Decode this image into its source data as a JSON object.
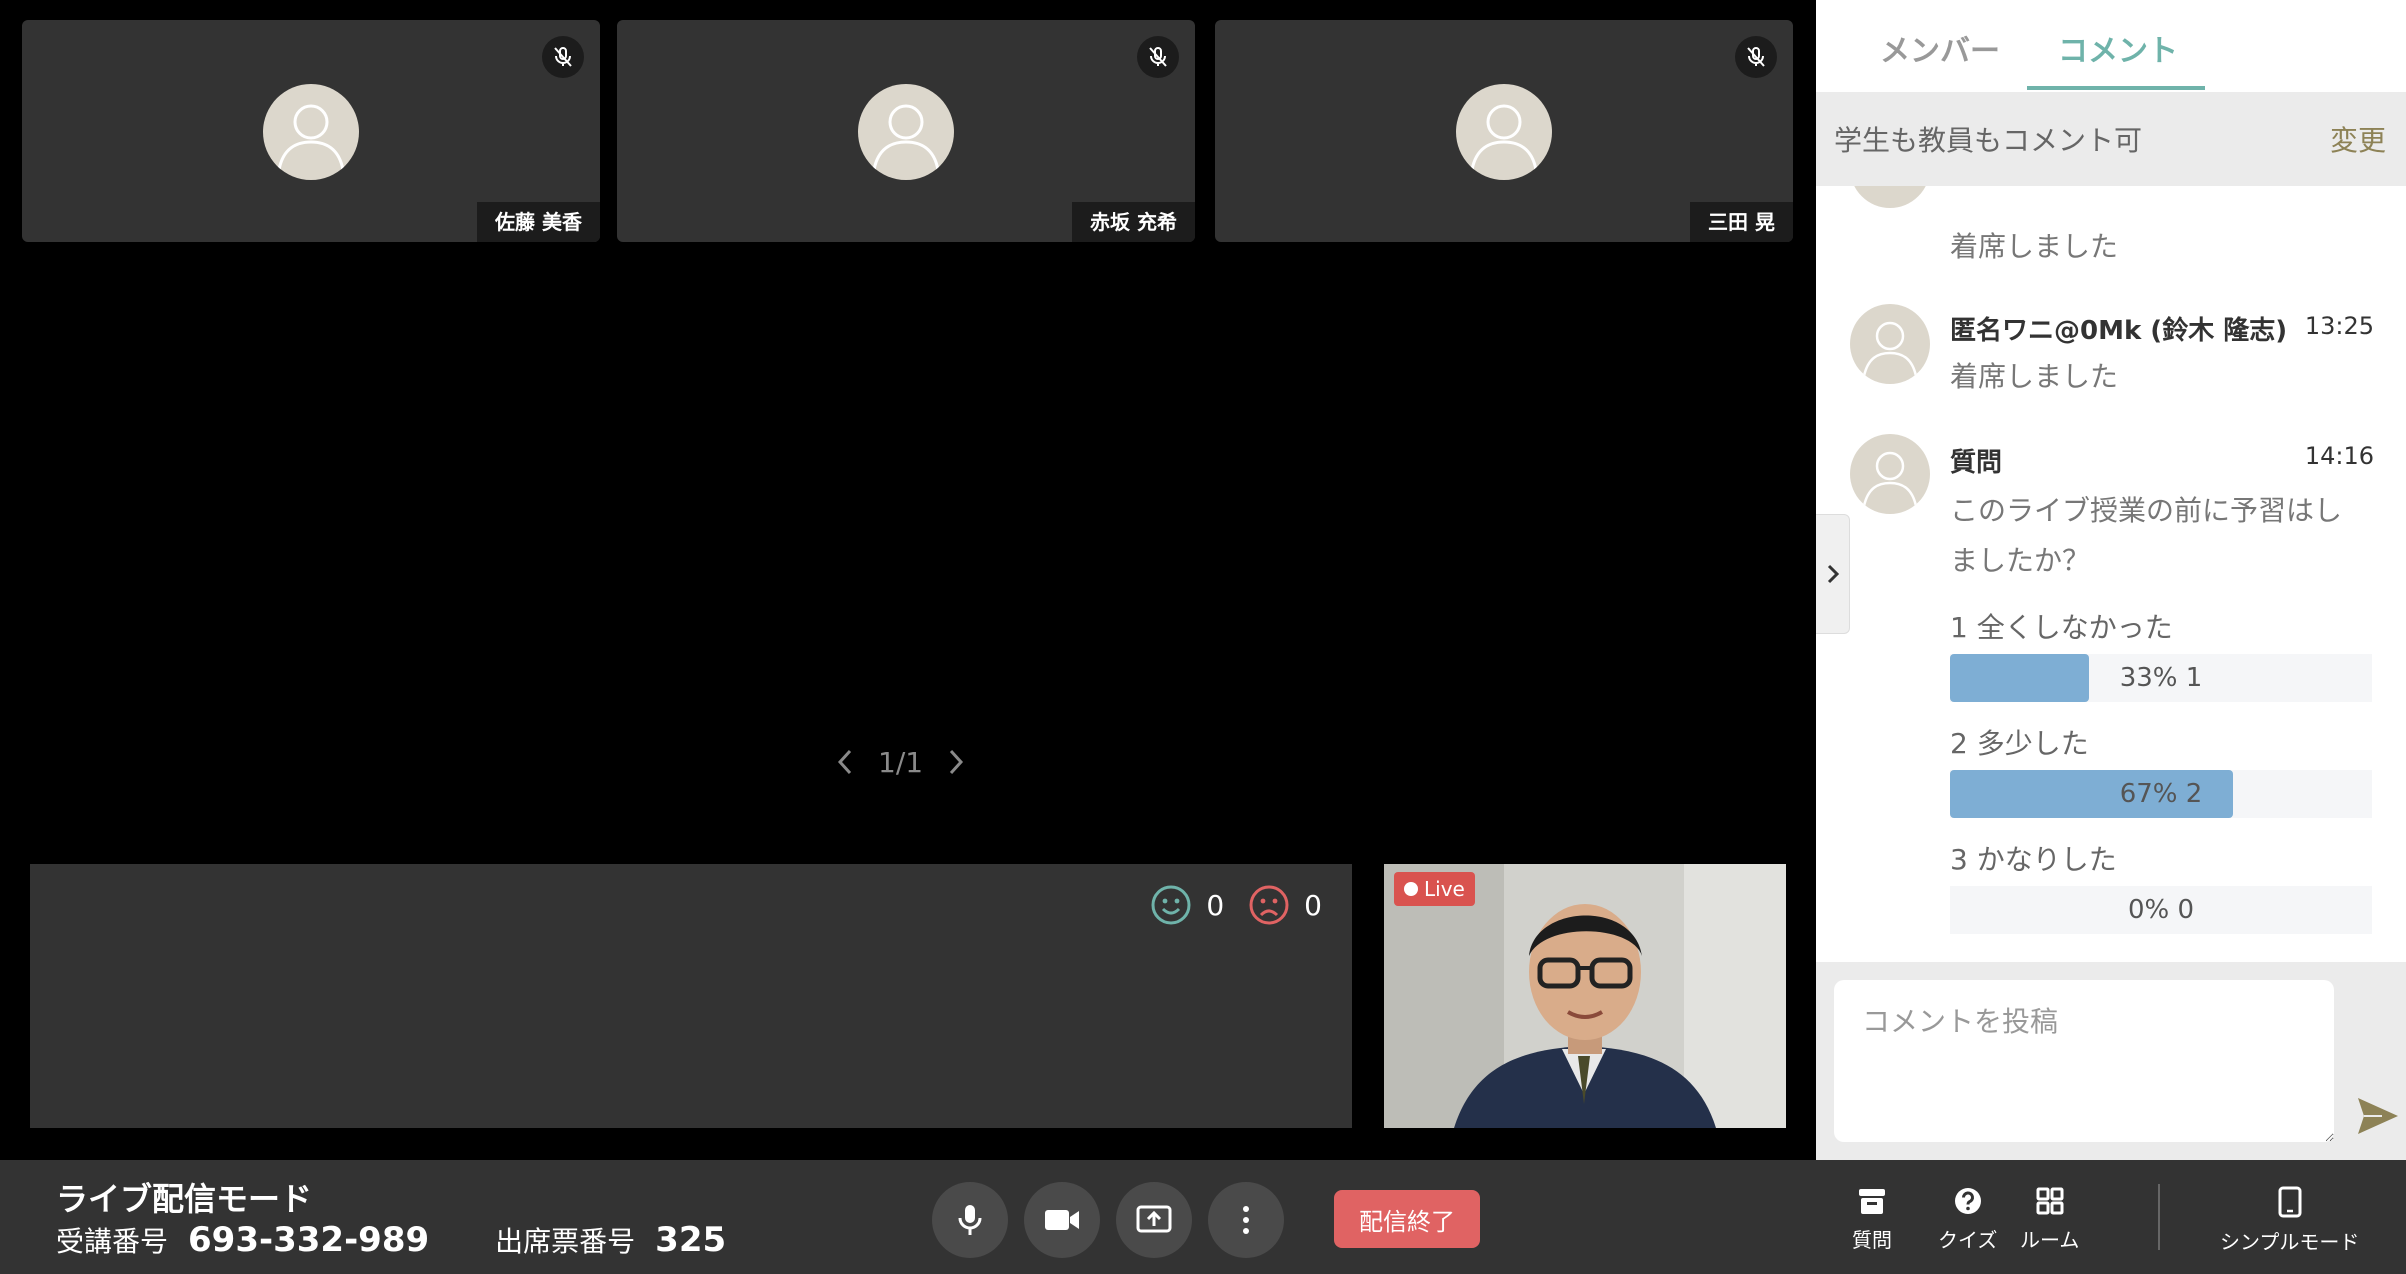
{
  "participants": [
    {
      "name": "佐藤 美香"
    },
    {
      "name": "赤坂 充希"
    },
    {
      "name": "三田 晃"
    }
  ],
  "pager": {
    "current": "1",
    "separator": "/",
    "total": "1"
  },
  "reactions": {
    "happy_count": "0",
    "sad_count": "0"
  },
  "self_view": {
    "live_label": "Live"
  },
  "toolbar": {
    "mode_title": "ライブ配信モード",
    "course_number_label": "受講番号",
    "course_number": "693-332-989",
    "attendance_label": "出席票番号",
    "attendance_number": "325",
    "end_label": "配信終了",
    "question_label": "質問",
    "quiz_label": "クイズ",
    "room_label": "ルーム",
    "simple_mode_label": "シンプルモード"
  },
  "side": {
    "tabs": [
      {
        "label": "メンバー"
      },
      {
        "label": "コメント"
      }
    ],
    "permission_text": "学生も教員もコメント可",
    "change_label": "変更",
    "comments": [
      {
        "text": "着席しました"
      },
      {
        "name": "匿名ワニ@0Mk (鈴木 隆志)",
        "time": "13:25",
        "text": "着席しました"
      },
      {
        "name": "質問",
        "time": "14:16",
        "text_line1": "このライブ授業の前に予習はし",
        "text_line2": "ましたか？"
      }
    ],
    "poll": {
      "options": [
        {
          "label": "1 全くしなかった",
          "result": "33% 1",
          "percent": 33
        },
        {
          "label": "2 多少した",
          "result": "67% 2",
          "percent": 67
        },
        {
          "label": "3 かなりした",
          "result": "0% 0",
          "percent": 0
        }
      ]
    },
    "compose_placeholder": "コメントを投稿"
  },
  "colors": {
    "accent": "#6fb3aa",
    "danger": "#e06363",
    "poll_bar": "#7eaed4",
    "change_link": "#8d8256"
  }
}
